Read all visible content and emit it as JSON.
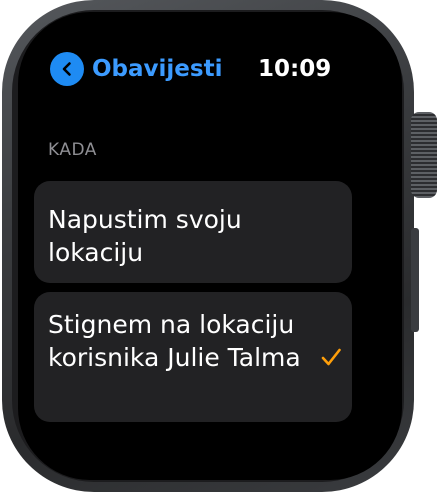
{
  "header": {
    "back_label": "Obavijesti",
    "time": "10:09"
  },
  "section": {
    "title": "KADA"
  },
  "options": [
    {
      "label": "Napustim svoju lokaciju",
      "selected": false
    },
    {
      "label": "Stignem na lokaciju korisnika Julie Talma",
      "selected": true
    }
  ],
  "colors": {
    "accent_blue": "#1e8bf3",
    "check_orange": "#ff9f0a"
  },
  "icons": {
    "back": "chevron-left-icon",
    "selected": "checkmark-icon"
  }
}
